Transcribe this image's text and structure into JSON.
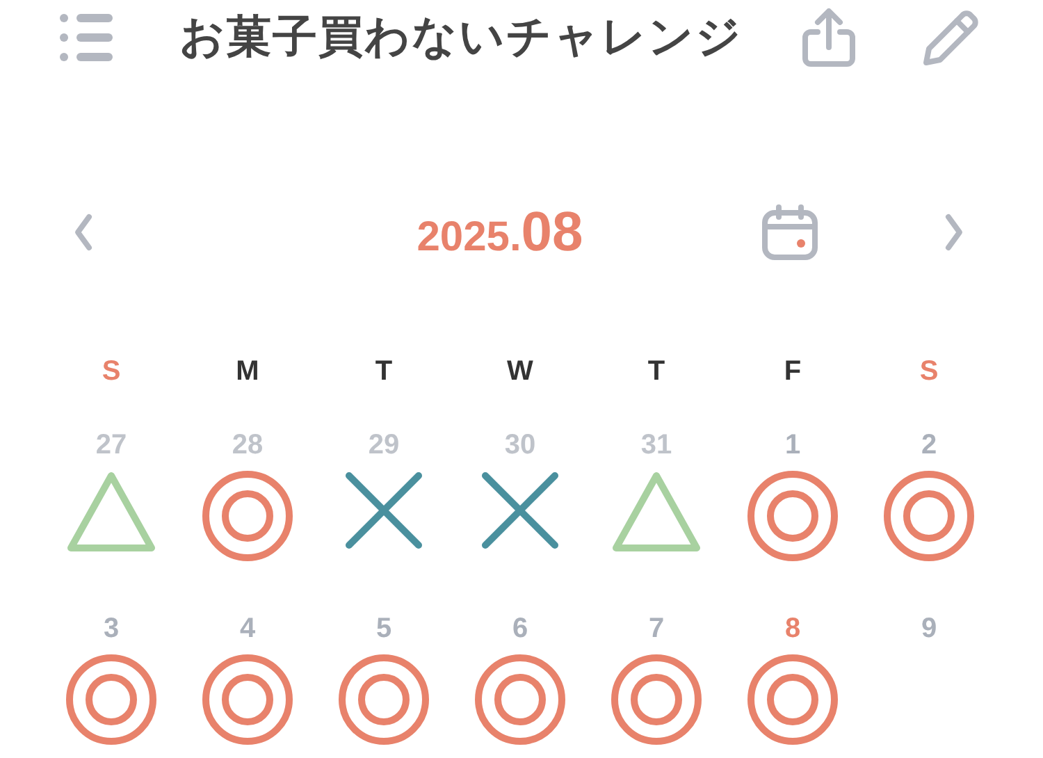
{
  "header": {
    "title": "お菓子買わないチャレンジ"
  },
  "month": {
    "year": "2025.",
    "month": "08"
  },
  "weekdays": [
    {
      "label": "S",
      "weekend": true
    },
    {
      "label": "M",
      "weekend": false
    },
    {
      "label": "T",
      "weekend": false
    },
    {
      "label": "W",
      "weekend": false
    },
    {
      "label": "T",
      "weekend": false
    },
    {
      "label": "F",
      "weekend": false
    },
    {
      "label": "S",
      "weekend": true
    }
  ],
  "days": [
    {
      "date": "27",
      "muted": true,
      "today": false,
      "kind": "triangle"
    },
    {
      "date": "28",
      "muted": true,
      "today": false,
      "kind": "double_circle"
    },
    {
      "date": "29",
      "muted": true,
      "today": false,
      "kind": "cross"
    },
    {
      "date": "30",
      "muted": true,
      "today": false,
      "kind": "cross"
    },
    {
      "date": "31",
      "muted": true,
      "today": false,
      "kind": "triangle"
    },
    {
      "date": "1",
      "muted": false,
      "today": false,
      "kind": "double_circle"
    },
    {
      "date": "2",
      "muted": false,
      "today": false,
      "kind": "double_circle"
    },
    {
      "date": "3",
      "muted": false,
      "today": false,
      "kind": "double_circle"
    },
    {
      "date": "4",
      "muted": false,
      "today": false,
      "kind": "double_circle"
    },
    {
      "date": "5",
      "muted": false,
      "today": false,
      "kind": "double_circle"
    },
    {
      "date": "6",
      "muted": false,
      "today": false,
      "kind": "double_circle"
    },
    {
      "date": "7",
      "muted": false,
      "today": false,
      "kind": "double_circle"
    },
    {
      "date": "8",
      "muted": false,
      "today": true,
      "kind": "double_circle"
    },
    {
      "date": "9",
      "muted": false,
      "today": false,
      "kind": "blank"
    }
  ]
}
